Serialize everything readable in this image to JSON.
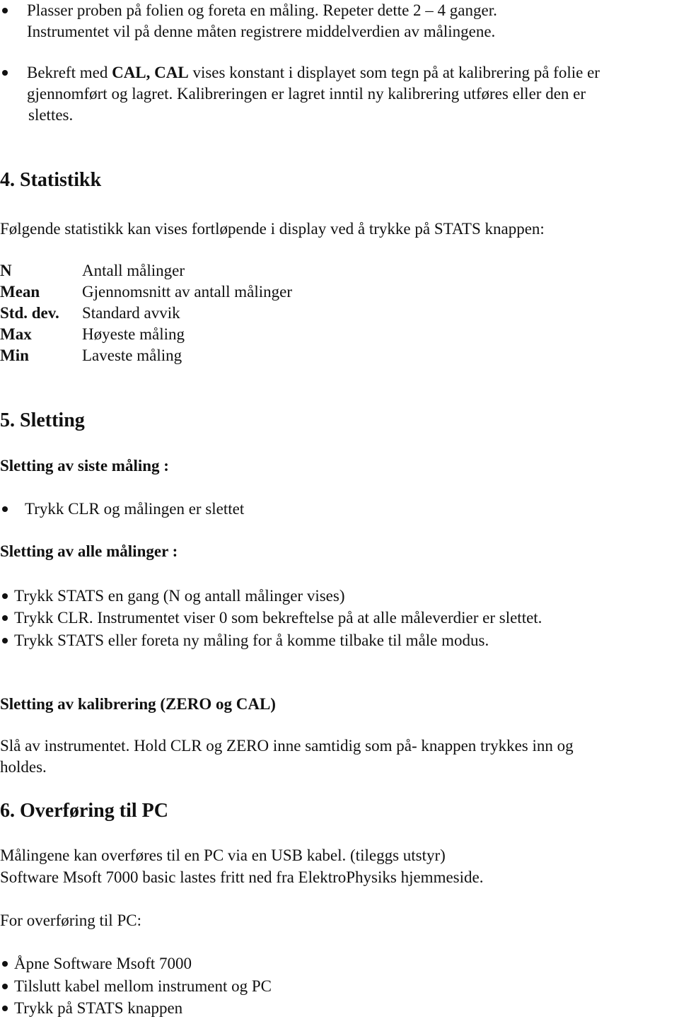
{
  "intro_bullets": [
    {
      "line1": "Plasser proben på folien og foreta en måling. Repeter dette 2 – 4 ganger.",
      "line2": "Instrumentet vil på denne måten registrere middelverdien av målingene."
    },
    {
      "pre": "Bekreft med ",
      "bold": "CAL, CAL",
      "post": " vises konstant i displayet som tegn på at kalibrering på folie er",
      "line2": "gjennomført og lagret. Kalibreringen er lagret inntil ny kalibrering utføres eller den er",
      "line3": "slettes."
    }
  ],
  "section4": {
    "heading": "4. Statistikk",
    "intro": "Følgende statistikk kan vises fortløpende i display ved å trykke på STATS knappen:",
    "definitions": [
      {
        "term": "N",
        "desc": "Antall målinger"
      },
      {
        "term": "Mean",
        "desc": "Gjennomsnitt av antall målinger"
      },
      {
        "term": "Std. dev.",
        "desc": "Standard avvik"
      },
      {
        "term": "Max",
        "desc": "Høyeste måling"
      },
      {
        "term": "Min",
        "desc": "Laveste måling"
      }
    ]
  },
  "section5": {
    "heading": "5. Sletting",
    "sub1": {
      "heading": "Sletting av siste måling :",
      "bullets": [
        "Trykk CLR og målingen er slettet"
      ]
    },
    "sub2": {
      "heading": "Sletting av alle målinger :",
      "bullets": [
        "Trykk STATS en gang (N og antall målinger vises)",
        "Trykk CLR. Instrumentet viser 0 som bekreftelse på at alle måleverdier er slettet.",
        "Trykk STATS eller foreta ny måling for å komme tilbake til måle modus."
      ]
    },
    "sub3": {
      "heading": "Sletting av kalibrering (ZERO og CAL)",
      "line1": "Slå av instrumentet. Hold CLR og ZERO inne samtidig som på- knappen trykkes inn og",
      "line2": "holdes."
    }
  },
  "section6": {
    "heading": "6. Overføring til PC",
    "line1": "Målingene kan overføres til en PC via en USB kabel. (tileggs utstyr)",
    "line2": "Software Msoft 7000  basic lastes fritt ned fra ElektroPhysiks hjemmeside.",
    "lead": "For overføring til PC:",
    "bullets": [
      "Åpne Software Msoft 7000",
      "Tilslutt kabel mellom instrument og PC",
      "Trykk på STATS knappen"
    ]
  }
}
